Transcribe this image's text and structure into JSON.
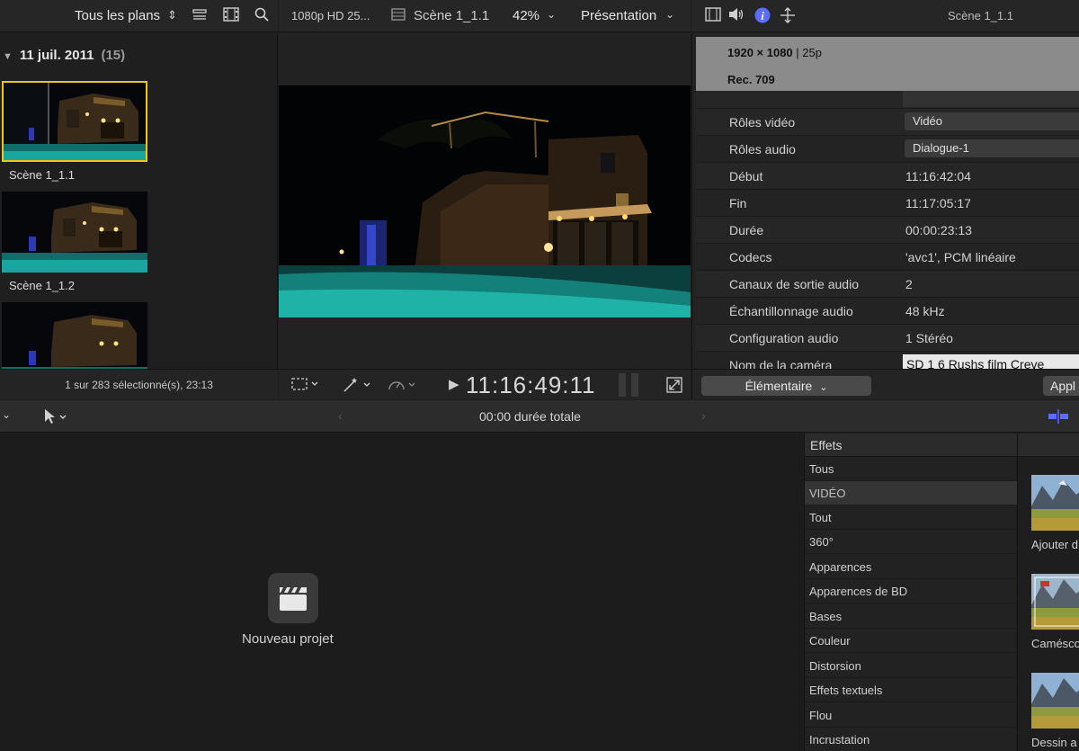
{
  "browser": {
    "filter_label": "Tous les plans",
    "date_group": "11 juil. 2011",
    "date_count": "(15)",
    "clips": [
      {
        "name": "Scène 1_1.1"
      },
      {
        "name": "Scène 1_1.2"
      },
      {
        "name": ""
      }
    ],
    "status": "1 sur 283 sélectionné(s), 23:13"
  },
  "viewer": {
    "format": "1080p HD 25...",
    "clip_name": "Scène 1_1.1",
    "zoom": "42%",
    "view_menu": "Présentation",
    "timecode": "11:16:49:11"
  },
  "inspector": {
    "title": "Scène 1_1.1",
    "resolution": "1920 × 1080",
    "frame_rate": "| 25p",
    "color_space": "Rec. 709",
    "properties": [
      {
        "label": "Rôles vidéo",
        "value": "Vidéo",
        "kind": "popup"
      },
      {
        "label": "Rôles audio",
        "value": "Dialogue-1",
        "kind": "popup"
      },
      {
        "label": "Début",
        "value": "11:16:42:04",
        "kind": "text"
      },
      {
        "label": "Fin",
        "value": "11:17:05:17",
        "kind": "text"
      },
      {
        "label": "Durée",
        "value": "00:00:23:13",
        "kind": "text"
      },
      {
        "label": "Codecs",
        "value": "'avc1', PCM linéaire",
        "kind": "text"
      },
      {
        "label": "Canaux de sortie audio",
        "value": "2",
        "kind": "text"
      },
      {
        "label": "Échantillonnage audio",
        "value": "48 kHz",
        "kind": "text"
      },
      {
        "label": "Configuration audio",
        "value": "1 Stéréo",
        "kind": "text"
      },
      {
        "label": "Nom de la caméra",
        "value": "SD 1 6 Rushs film Creve",
        "kind": "field"
      }
    ],
    "metadata_view": "Élémentaire",
    "apply_button": "Appl"
  },
  "timeline": {
    "duration_text": "00:00 durée totale",
    "new_project": "Nouveau projet"
  },
  "effects": {
    "title": "Effets",
    "items": [
      "Tous",
      "VIDÉO",
      "Tout",
      "360°",
      "Apparences",
      "Apparences de BD",
      "Bases",
      "Couleur",
      "Distorsion",
      "Effets textuels",
      "Flou",
      "Incrustation"
    ],
    "thumbnails": [
      "Ajouter d",
      "Camésco",
      "Dessin a"
    ]
  },
  "colors": {
    "selection": "#f0c419",
    "accent_blue": "#5b6cff",
    "pool": "#1fb3a8"
  }
}
